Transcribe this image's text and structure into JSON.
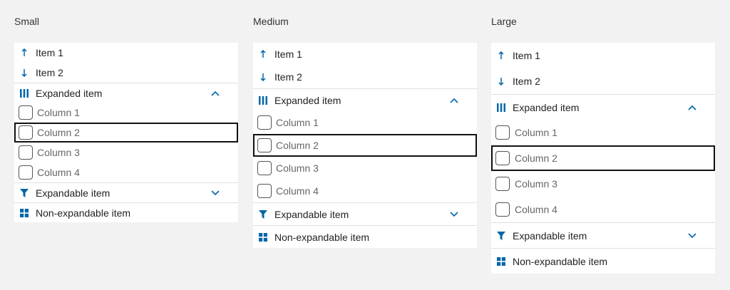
{
  "accent_color": "#0066a8",
  "sizes": [
    {
      "title": "Small",
      "items": {
        "item1": "Item 1",
        "item2": "Item 2",
        "expanded": "Expanded item",
        "columns": [
          "Column 1",
          "Column 2",
          "Column 3",
          "Column 4"
        ],
        "expandable": "Expandable item",
        "nonexpandable": "Non-expandable item"
      }
    },
    {
      "title": "Medium",
      "items": {
        "item1": "Item 1",
        "item2": "Item 2",
        "expanded": "Expanded item",
        "columns": [
          "Column 1",
          "Column 2",
          "Column 3",
          "Column 4"
        ],
        "expandable": "Expandable item",
        "nonexpandable": "Non-expandable item"
      }
    },
    {
      "title": "Large",
      "items": {
        "item1": "Item 1",
        "item2": "Item 2",
        "expanded": "Expanded item",
        "columns": [
          "Column 1",
          "Column 2",
          "Column 3",
          "Column 4"
        ],
        "expandable": "Expandable item",
        "nonexpandable": "Non-expandable item"
      }
    }
  ],
  "icons": {
    "item1": "arrow-up-icon",
    "item2": "arrow-down-icon",
    "expanded": "columns-icon",
    "expanded_toggle": "chevron-up-icon",
    "expandable": "filter-icon",
    "expandable_toggle": "chevron-down-icon",
    "nonexpandable": "grid-icon"
  },
  "focused_column_index": 1
}
